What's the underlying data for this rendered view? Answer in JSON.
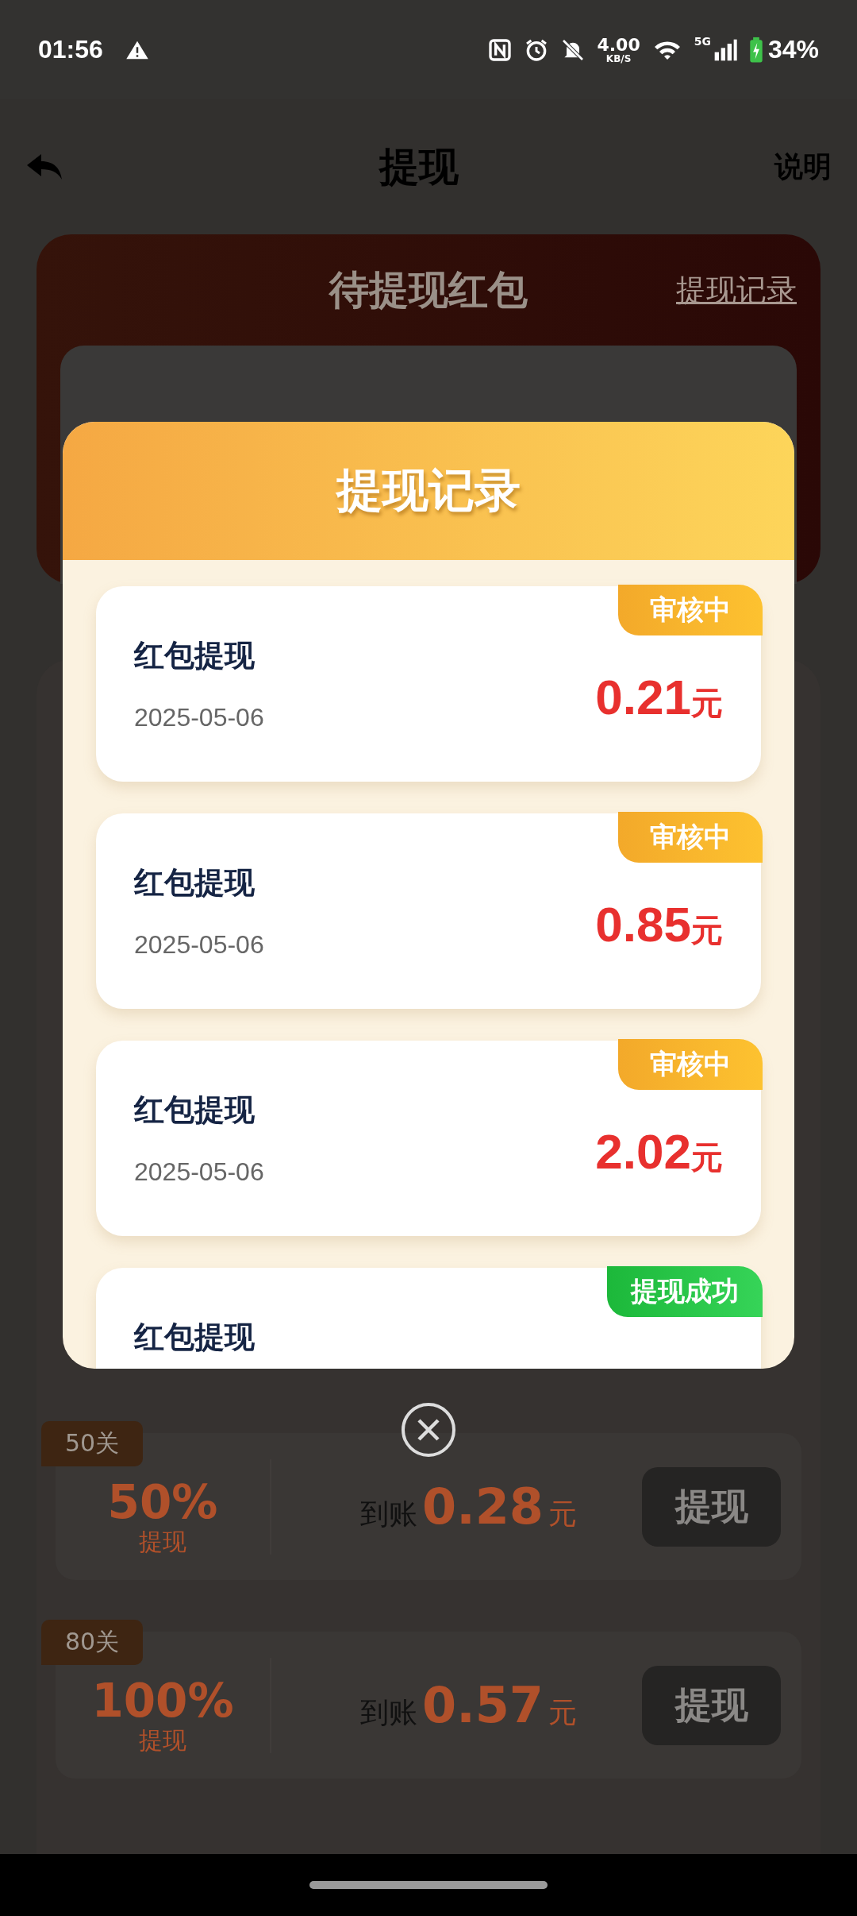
{
  "status_bar": {
    "time": "01:56",
    "speed_value": "4.00",
    "speed_unit": "KB/S",
    "network": "5G",
    "battery": "34%"
  },
  "header": {
    "title": "提现",
    "action": "说明"
  },
  "balance_card": {
    "title": "待提现红包",
    "link": "提现记录"
  },
  "tiers": [
    {
      "tag": "50关",
      "percent": "50%",
      "percent_label": "提现",
      "amount_label": "到账",
      "amount": "0.28",
      "unit": "元",
      "button": "提现"
    },
    {
      "tag": "80关",
      "percent": "100%",
      "percent_label": "提现",
      "amount_label": "到账",
      "amount": "0.57",
      "unit": "元",
      "button": "提现"
    }
  ],
  "modal": {
    "title": "提现记录",
    "records": [
      {
        "title": "红包提现",
        "date": "2025-05-06",
        "amount": "0.21",
        "unit": "元",
        "status": "审核中",
        "kind": "pending"
      },
      {
        "title": "红包提现",
        "date": "2025-05-06",
        "amount": "0.85",
        "unit": "元",
        "status": "审核中",
        "kind": "pending"
      },
      {
        "title": "红包提现",
        "date": "2025-05-06",
        "amount": "2.02",
        "unit": "元",
        "status": "审核中",
        "kind": "pending"
      },
      {
        "title": "红包提现",
        "status": "提现成功",
        "kind": "success"
      }
    ]
  }
}
